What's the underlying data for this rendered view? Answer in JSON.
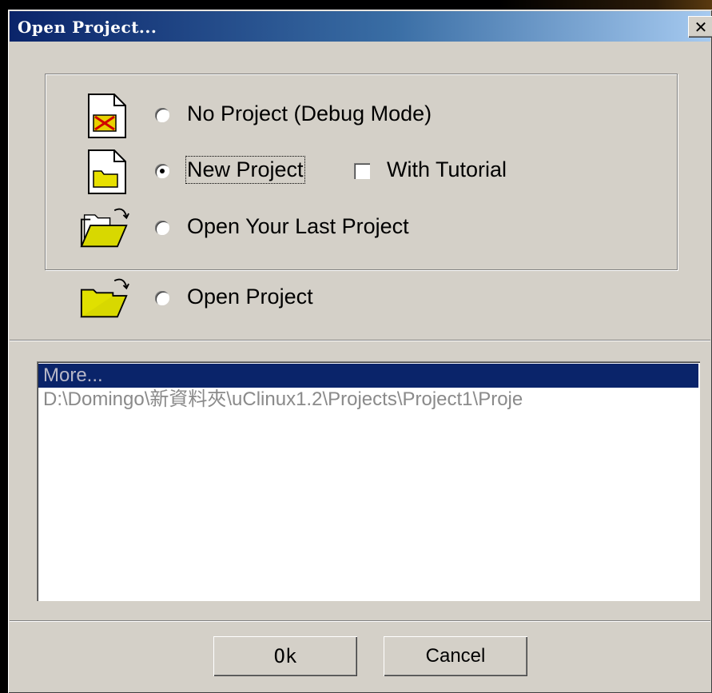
{
  "window": {
    "title": "Open Project...",
    "close_label": "✕"
  },
  "options": {
    "no_project": "No Project (Debug Mode)",
    "new_project": "New Project",
    "with_tutorial": "With Tutorial",
    "open_last": "Open Your Last Project",
    "open_project": "Open Project"
  },
  "selected_option": "new_project",
  "with_tutorial_checked": false,
  "recent_list": [
    {
      "label": "More..."
    },
    {
      "label": "D:\\Domingo\\新資料夾\\uClinux1.2\\Projects\\Project1\\Proje"
    }
  ],
  "buttons": {
    "ok": "Ok",
    "cancel": "Cancel"
  },
  "colors": {
    "title_start": "#0a246a",
    "title_end": "#a6caf0",
    "face": "#d4d0c8",
    "selection": "#0a246a",
    "folder_yellow": "#d8d800"
  },
  "icons": {
    "no_project": "document-with-cross-icon",
    "new_project": "document-with-folder-icon",
    "open_last": "open-folder-with-arrow-icon",
    "open_project": "open-folder-with-arrow-icon"
  }
}
